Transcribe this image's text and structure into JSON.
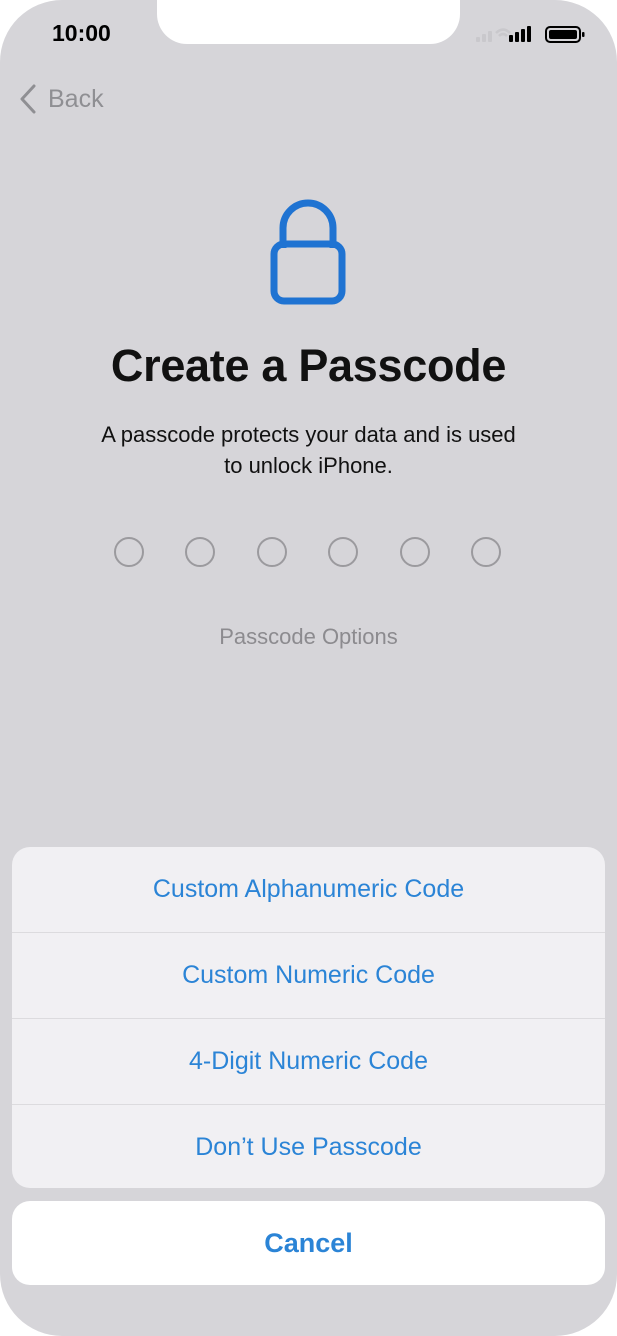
{
  "status_bar": {
    "time": "10:00"
  },
  "nav": {
    "back_label": "Back"
  },
  "header": {
    "title": "Create a Passcode",
    "subtitle_line1": "A passcode protects your data and is used",
    "subtitle_line2": "to unlock iPhone."
  },
  "passcode": {
    "digit_count": 6,
    "entered": 0
  },
  "options_link": "Passcode Options",
  "action_sheet": {
    "items": [
      {
        "label": "Custom Alphanumeric Code"
      },
      {
        "label": "Custom Numeric Code"
      },
      {
        "label": "4-Digit Numeric Code"
      },
      {
        "label": "Don’t Use Passcode"
      }
    ],
    "cancel_label": "Cancel"
  },
  "colors": {
    "accent": "#2b84d6",
    "lock_icon": "#1f73d2",
    "background": "#d6d5d9"
  },
  "icons": {
    "back": "chevron-left-icon",
    "lock": "lock-icon",
    "signal": "signal-icon",
    "wifi": "wifi-icon",
    "battery": "battery-icon"
  }
}
